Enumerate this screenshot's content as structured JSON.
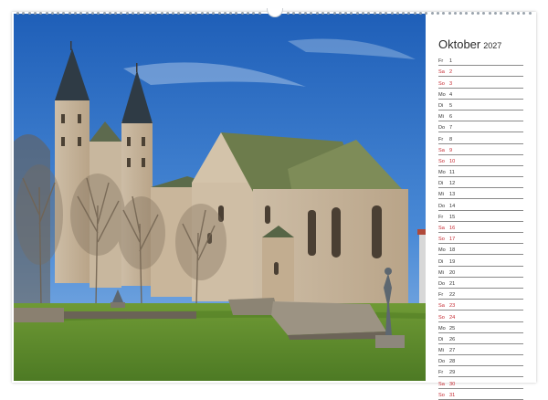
{
  "calendar": {
    "month": "Oktober",
    "year": "2027",
    "days": [
      {
        "dow": "Fr",
        "num": "1",
        "weekend": false
      },
      {
        "dow": "Sa",
        "num": "2",
        "weekend": true
      },
      {
        "dow": "So",
        "num": "3",
        "weekend": true
      },
      {
        "dow": "Mo",
        "num": "4",
        "weekend": false
      },
      {
        "dow": "Di",
        "num": "5",
        "weekend": false
      },
      {
        "dow": "Mi",
        "num": "6",
        "weekend": false
      },
      {
        "dow": "Do",
        "num": "7",
        "weekend": false
      },
      {
        "dow": "Fr",
        "num": "8",
        "weekend": false
      },
      {
        "dow": "Sa",
        "num": "9",
        "weekend": true
      },
      {
        "dow": "So",
        "num": "10",
        "weekend": true
      },
      {
        "dow": "Mo",
        "num": "11",
        "weekend": false
      },
      {
        "dow": "Di",
        "num": "12",
        "weekend": false
      },
      {
        "dow": "Mi",
        "num": "13",
        "weekend": false
      },
      {
        "dow": "Do",
        "num": "14",
        "weekend": false
      },
      {
        "dow": "Fr",
        "num": "15",
        "weekend": false
      },
      {
        "dow": "Sa",
        "num": "16",
        "weekend": true
      },
      {
        "dow": "So",
        "num": "17",
        "weekend": true
      },
      {
        "dow": "Mo",
        "num": "18",
        "weekend": false
      },
      {
        "dow": "Di",
        "num": "19",
        "weekend": false
      },
      {
        "dow": "Mi",
        "num": "20",
        "weekend": false
      },
      {
        "dow": "Do",
        "num": "21",
        "weekend": false
      },
      {
        "dow": "Fr",
        "num": "22",
        "weekend": false
      },
      {
        "dow": "Sa",
        "num": "23",
        "weekend": true
      },
      {
        "dow": "So",
        "num": "24",
        "weekend": true
      },
      {
        "dow": "Mo",
        "num": "25",
        "weekend": false
      },
      {
        "dow": "Di",
        "num": "26",
        "weekend": false
      },
      {
        "dow": "Mi",
        "num": "27",
        "weekend": false
      },
      {
        "dow": "Do",
        "num": "28",
        "weekend": false
      },
      {
        "dow": "Fr",
        "num": "29",
        "weekend": false
      },
      {
        "dow": "Sa",
        "num": "30",
        "weekend": true
      },
      {
        "dow": "So",
        "num": "31",
        "weekend": true
      }
    ]
  },
  "colors": {
    "weekend": "#c4262e",
    "weekday": "#333333",
    "sky": "#2f73c9",
    "lawn": "#5f8a2c"
  },
  "photo": {
    "subject": "romanesque-church-with-twin-towers"
  }
}
